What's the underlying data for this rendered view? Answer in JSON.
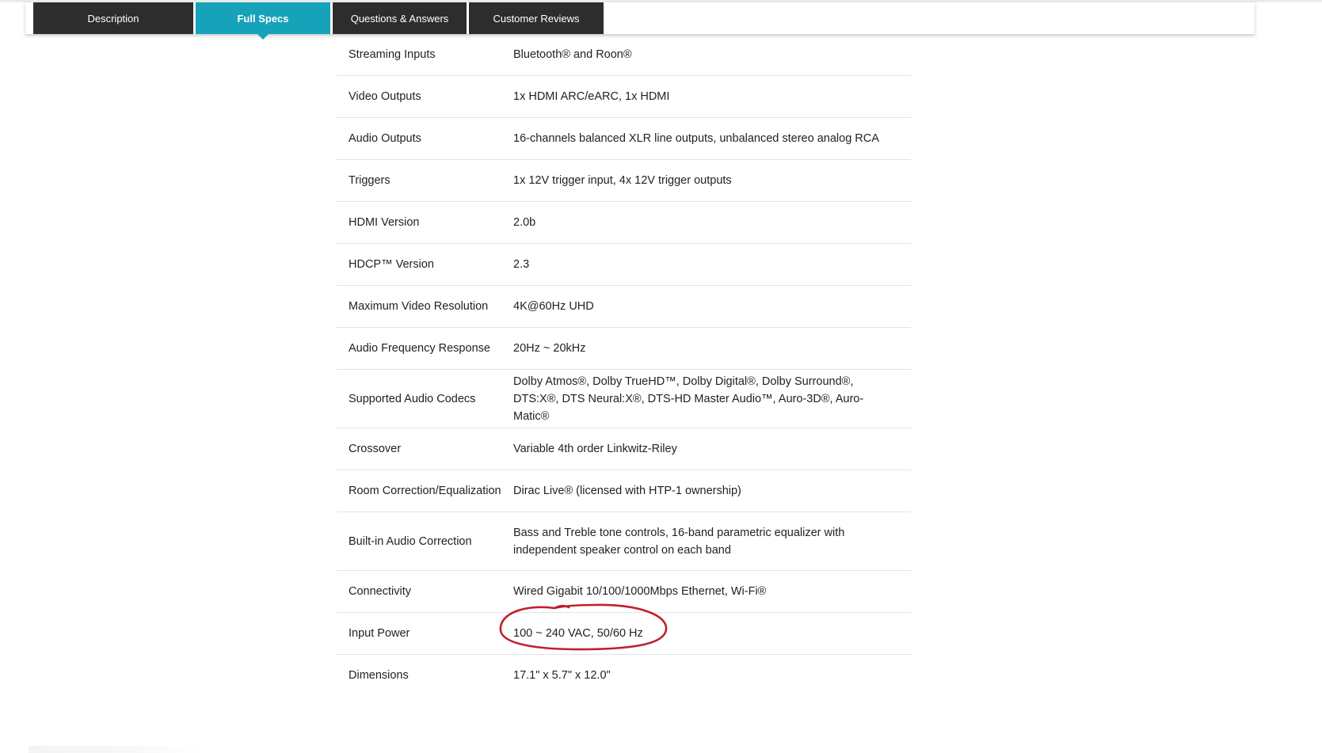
{
  "tabs": [
    {
      "label": "Description"
    },
    {
      "label": "Full Specs"
    },
    {
      "label": "Questions & Answers"
    },
    {
      "label": "Customer Reviews"
    }
  ],
  "specs": [
    {
      "label": "Streaming Inputs",
      "value": "Bluetooth® and Roon®"
    },
    {
      "label": "Video Outputs",
      "value": "1x HDMI ARC/eARC, 1x HDMI"
    },
    {
      "label": "Audio Outputs",
      "value": "16-channels balanced XLR line outputs, unbalanced stereo analog RCA"
    },
    {
      "label": "Triggers",
      "value": "1x 12V trigger input, 4x 12V trigger outputs"
    },
    {
      "label": "HDMI Version",
      "value": "2.0b"
    },
    {
      "label": "HDCP™ Version",
      "value": "2.3"
    },
    {
      "label": "Maximum Video Resolution",
      "value": "4K@60Hz UHD"
    },
    {
      "label": "Audio Frequency Response",
      "value": "20Hz ~ 20kHz"
    },
    {
      "label": "Supported Audio Codecs",
      "value": "Dolby Atmos®, Dolby TrueHD™, Dolby Digital®, Dolby Surround®, DTS:X®, DTS Neural:X®, DTS-HD Master Audio™, Auro-3D®, Auro-Matic®"
    },
    {
      "label": "Crossover",
      "value": "Variable 4th order Linkwitz-Riley"
    },
    {
      "label": "Room Correction/Equalization",
      "value": "Dirac Live® (licensed with HTP-1 ownership)"
    },
    {
      "label": "Built-in Audio Correction",
      "value": "Bass and Treble tone controls, 16-band parametric equalizer with independent speaker control on each band"
    },
    {
      "label": "Connectivity",
      "value": "Wired Gigabit 10/100/1000Mbps Ethernet, Wi-Fi®"
    },
    {
      "label": "Input Power",
      "value": "100 ~ 240 VAC, 50/60 Hz"
    },
    {
      "label": "Dimensions",
      "value": "17.1\" x 5.7\" x 12.0\""
    }
  ],
  "colors": {
    "tab_dark": "#2d2d2d",
    "tab_active": "#16a2b8",
    "annotation": "#c0202a"
  }
}
